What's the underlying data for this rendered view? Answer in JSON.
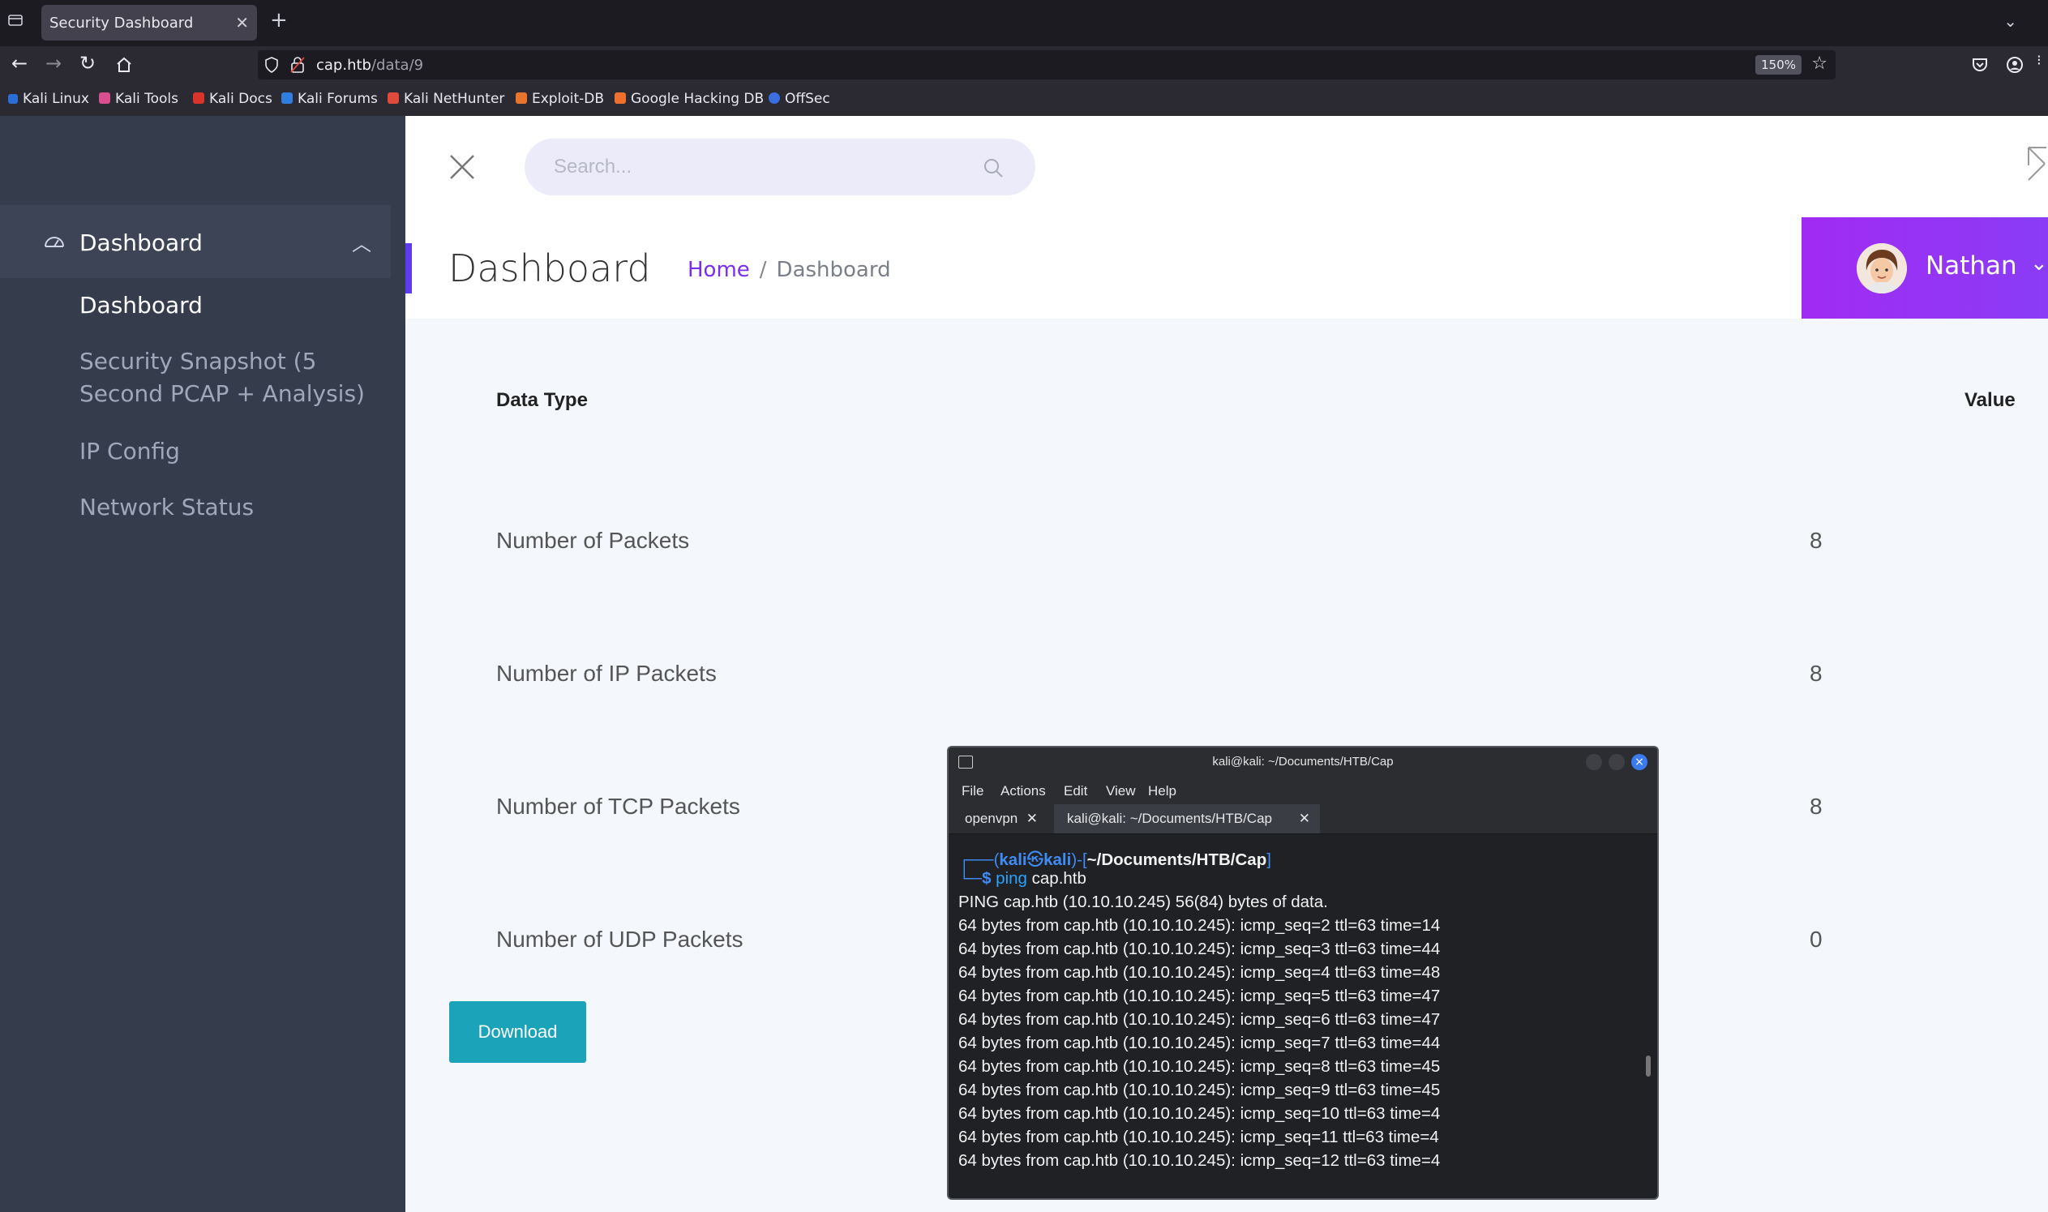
{
  "browser": {
    "tab_title": "Security Dashboard",
    "url_host": "cap.htb",
    "url_path": "/data/9",
    "zoom": "150%",
    "bookmarks": [
      "Kali Linux",
      "Kali Tools",
      "Kali Docs",
      "Kali Forums",
      "Kali NetHunter",
      "Exploit-DB",
      "Google Hacking DB",
      "OffSec"
    ]
  },
  "sidebar": {
    "section_label": "Dashboard",
    "items": [
      {
        "label": "Dashboard"
      },
      {
        "label": "Security Snapshot (5"
      },
      {
        "label": "Second PCAP + Analysis)"
      },
      {
        "label": "IP Config"
      },
      {
        "label": "Network Status"
      }
    ]
  },
  "topbar": {
    "search_placeholder": "Search..."
  },
  "header": {
    "page_title": "Dashboard",
    "breadcrumb_home": "Home",
    "breadcrumb_sep": "/",
    "breadcrumb_current": "Dashboard",
    "user_name": "Nathan"
  },
  "table": {
    "col_type": "Data Type",
    "col_value": "Value",
    "rows": [
      {
        "label": "Number of Packets",
        "value": "8"
      },
      {
        "label": "Number of IP Packets",
        "value": "8"
      },
      {
        "label": "Number of TCP Packets",
        "value": "8"
      },
      {
        "label": "Number of UDP Packets",
        "value": "0"
      }
    ],
    "download_label": "Download"
  },
  "terminal": {
    "title": "kali@kali: ~/Documents/HTB/Cap",
    "menu": [
      "File",
      "Actions",
      "Edit",
      "View",
      "Help"
    ],
    "tabs": [
      "openvpn",
      "kali@kali: ~/Documents/HTB/Cap"
    ],
    "prompt_user": "kali",
    "prompt_host": "kali",
    "prompt_path": "~/Documents/HTB/Cap",
    "command": "ping",
    "command_arg": "cap.htb",
    "lines": [
      "PING cap.htb (10.10.10.245) 56(84) bytes of data.",
      "64 bytes from cap.htb (10.10.10.245): icmp_seq=2 ttl=63 time=14",
      "64 bytes from cap.htb (10.10.10.245): icmp_seq=3 ttl=63 time=44",
      "64 bytes from cap.htb (10.10.10.245): icmp_seq=4 ttl=63 time=48",
      "64 bytes from cap.htb (10.10.10.245): icmp_seq=5 ttl=63 time=47",
      "64 bytes from cap.htb (10.10.10.245): icmp_seq=6 ttl=63 time=47",
      "64 bytes from cap.htb (10.10.10.245): icmp_seq=7 ttl=63 time=44",
      "64 bytes from cap.htb (10.10.10.245): icmp_seq=8 ttl=63 time=45",
      "64 bytes from cap.htb (10.10.10.245): icmp_seq=9 ttl=63 time=45",
      "64 bytes from cap.htb (10.10.10.245): icmp_seq=10 ttl=63 time=4",
      "64 bytes from cap.htb (10.10.10.245): icmp_seq=11 ttl=63 time=4",
      "64 bytes from cap.htb (10.10.10.245): icmp_seq=12 ttl=63 time=4"
    ]
  },
  "colors": {
    "sidebar_bg": "#353d4d",
    "accent_purple": "#8a3cf5",
    "download_teal": "#1aa3b9",
    "terminal_bg": "#1f2124"
  }
}
